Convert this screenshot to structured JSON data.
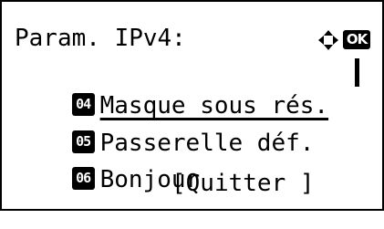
{
  "header": {
    "title": "Param. IPv4:",
    "nav_icon": "four-way-arrow-icon",
    "ok_label": "OK"
  },
  "menu": {
    "items": [
      {
        "number": "04",
        "label": "Masque sous rés.",
        "selected": true
      },
      {
        "number": "05",
        "label": "Passerelle déf.",
        "selected": false
      },
      {
        "number": "06",
        "label": "Bonjour",
        "selected": false
      }
    ]
  },
  "footer": {
    "quit_label": "[Quitter ]"
  }
}
